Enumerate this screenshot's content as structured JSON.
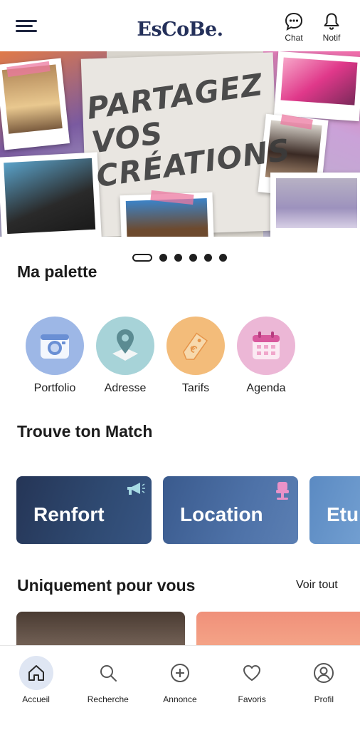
{
  "header": {
    "logo": "EsCoBe.",
    "chat_label": "Chat",
    "notif_label": "Notif"
  },
  "banner": {
    "headline": "PARTAGEZ VOS CRÉATIONS",
    "slides_count": 6,
    "active_slide": 1
  },
  "palette": {
    "title": "Ma palette",
    "items": [
      {
        "label": "Portfolio",
        "icon": "camera-icon"
      },
      {
        "label": "Adresse",
        "icon": "map-pin-icon"
      },
      {
        "label": "Tarifs",
        "icon": "price-tag-icon"
      },
      {
        "label": "Agenda",
        "icon": "calendar-icon"
      }
    ]
  },
  "match": {
    "title": "Trouve ton Match",
    "cards": [
      {
        "label": "Renfort",
        "icon": "megaphone-icon"
      },
      {
        "label": "Location",
        "icon": "salon-chair-icon"
      },
      {
        "label": "Etu"
      }
    ]
  },
  "for_you": {
    "title": "Uniquement pour vous",
    "see_all": "Voir tout"
  },
  "bottom_nav": {
    "items": [
      {
        "label": "Accueil",
        "icon": "home-icon",
        "active": true
      },
      {
        "label": "Recherche",
        "icon": "search-icon"
      },
      {
        "label": "Annonce",
        "icon": "plus-circle-icon"
      },
      {
        "label": "Favoris",
        "icon": "heart-icon"
      },
      {
        "label": "Profil",
        "icon": "user-icon"
      }
    ]
  },
  "colors": {
    "brand_navy": "#24305a",
    "accent_pink": "#ec78a0"
  }
}
